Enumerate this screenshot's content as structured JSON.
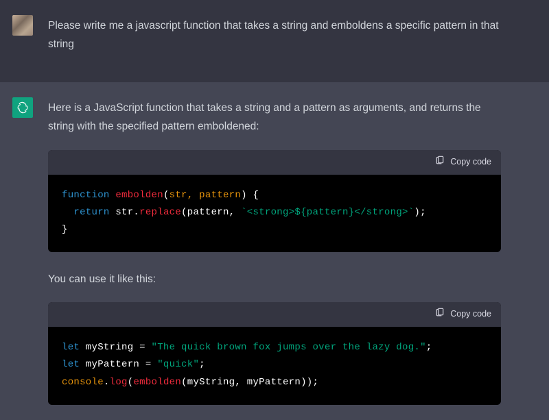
{
  "messages": {
    "user": {
      "text": "Please write me a javascript function that takes a string and emboldens a specific pattern in that string"
    },
    "assistant": {
      "intro": "Here is a JavaScript function that takes a string and a pattern as arguments, and returns the string with the specified pattern emboldened:",
      "mid": "You can use it like this:"
    }
  },
  "code": {
    "copy_label": "Copy code",
    "block1": {
      "kw_function": "function",
      "fn_name": "embolden",
      "params_open": "(",
      "param_str": "str, pattern",
      "params_close": ") {",
      "kw_return": "return",
      "ret_expr_a": " str.",
      "method_replace": "replace",
      "ret_expr_b": "(pattern, ",
      "template_string": "`<strong>${pattern}</strong>`",
      "ret_expr_c": ");",
      "close": "}"
    },
    "block2": {
      "kw_let1": "let",
      "var1": " myString = ",
      "str1": "\"The quick brown fox jumps over the lazy dog.\"",
      "semi1": ";",
      "kw_let2": "let",
      "var2": " myPattern = ",
      "str2": "\"quick\"",
      "semi2": ";",
      "console": "console",
      "dot": ".",
      "log": "log",
      "call_open": "(",
      "call_fn": "embolden",
      "call_args": "(myString, myPattern));"
    }
  }
}
